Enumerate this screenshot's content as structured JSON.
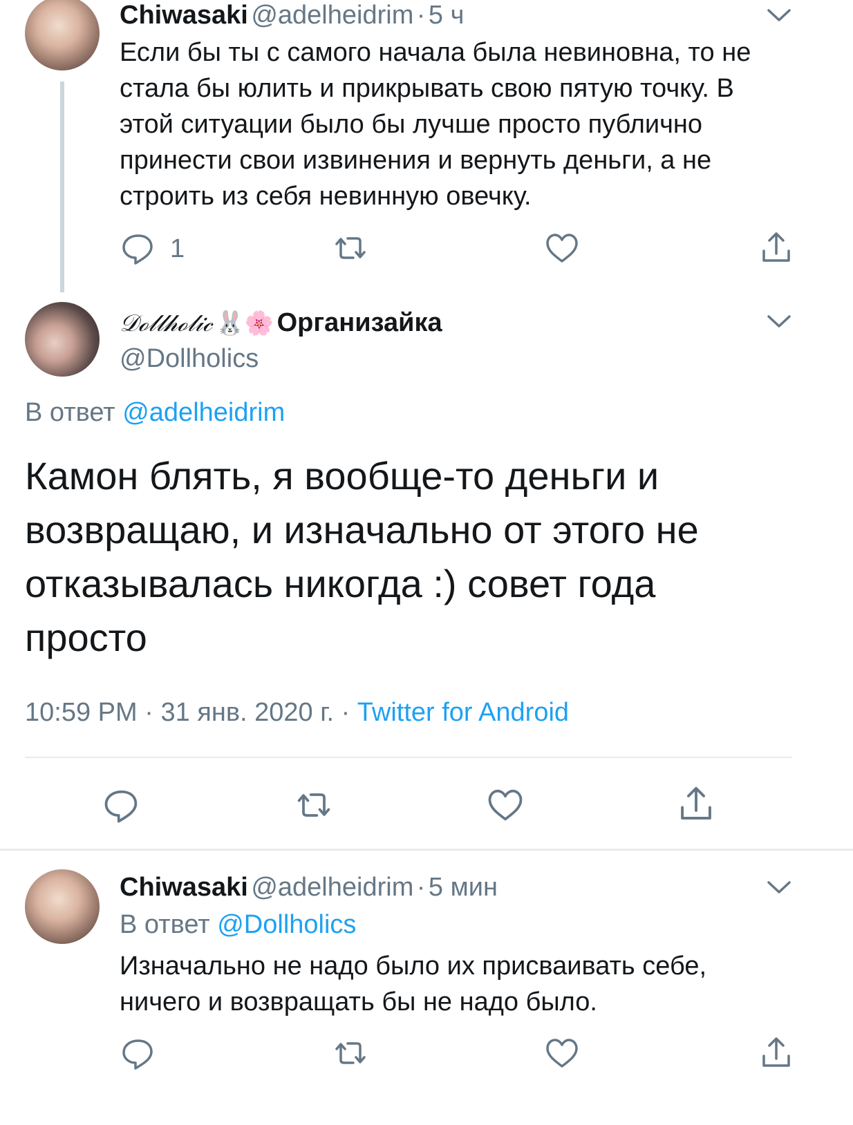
{
  "tweet1": {
    "name": "Chiwasaki",
    "handle": "@adelheidrim",
    "sep": "·",
    "time": "5 ч",
    "text": "Если бы ты с самого начала была невиновна, то не стала бы юлить и прикрывать свою пятую точку. В этой ситуации было бы лучше просто публично принести свои извинения и вернуть деньги, а не строить из себя невинную овечку.",
    "reply_count": "1"
  },
  "main": {
    "display_name": "𝒟ℴ𝓁𝓁𝒽ℴ𝓁𝒾𝒸",
    "emoji": "🐰🌸",
    "name_suffix": "Организайка",
    "handle": "@Dollholics",
    "reply_prefix": "В ответ",
    "reply_handle": "@adelheidrim",
    "text": "Камон блять, я вообще-то деньги и возвращаю, и изначально от этого не отказывалась никогда :) совет года просто",
    "time": "10:59 PM",
    "sep1": "·",
    "date": "31 янв. 2020 г.",
    "sep2": "·",
    "source": "Twitter for Android"
  },
  "tweet3": {
    "name": "Chiwasaki",
    "handle": "@adelheidrim",
    "sep": "·",
    "time": "5 мин",
    "reply_prefix": "В ответ",
    "reply_handle": "@Dollholics",
    "text": "Изначально не надо было их присваивать себе, ничего и возвращать бы не надо было."
  },
  "colors": {
    "text": "#14171a",
    "secondary": "#657786",
    "link": "#1da1f2",
    "divider": "#e6ecf0"
  },
  "icons": [
    "reply-icon",
    "retweet-icon",
    "like-icon",
    "share-icon",
    "chevron-down-icon"
  ]
}
